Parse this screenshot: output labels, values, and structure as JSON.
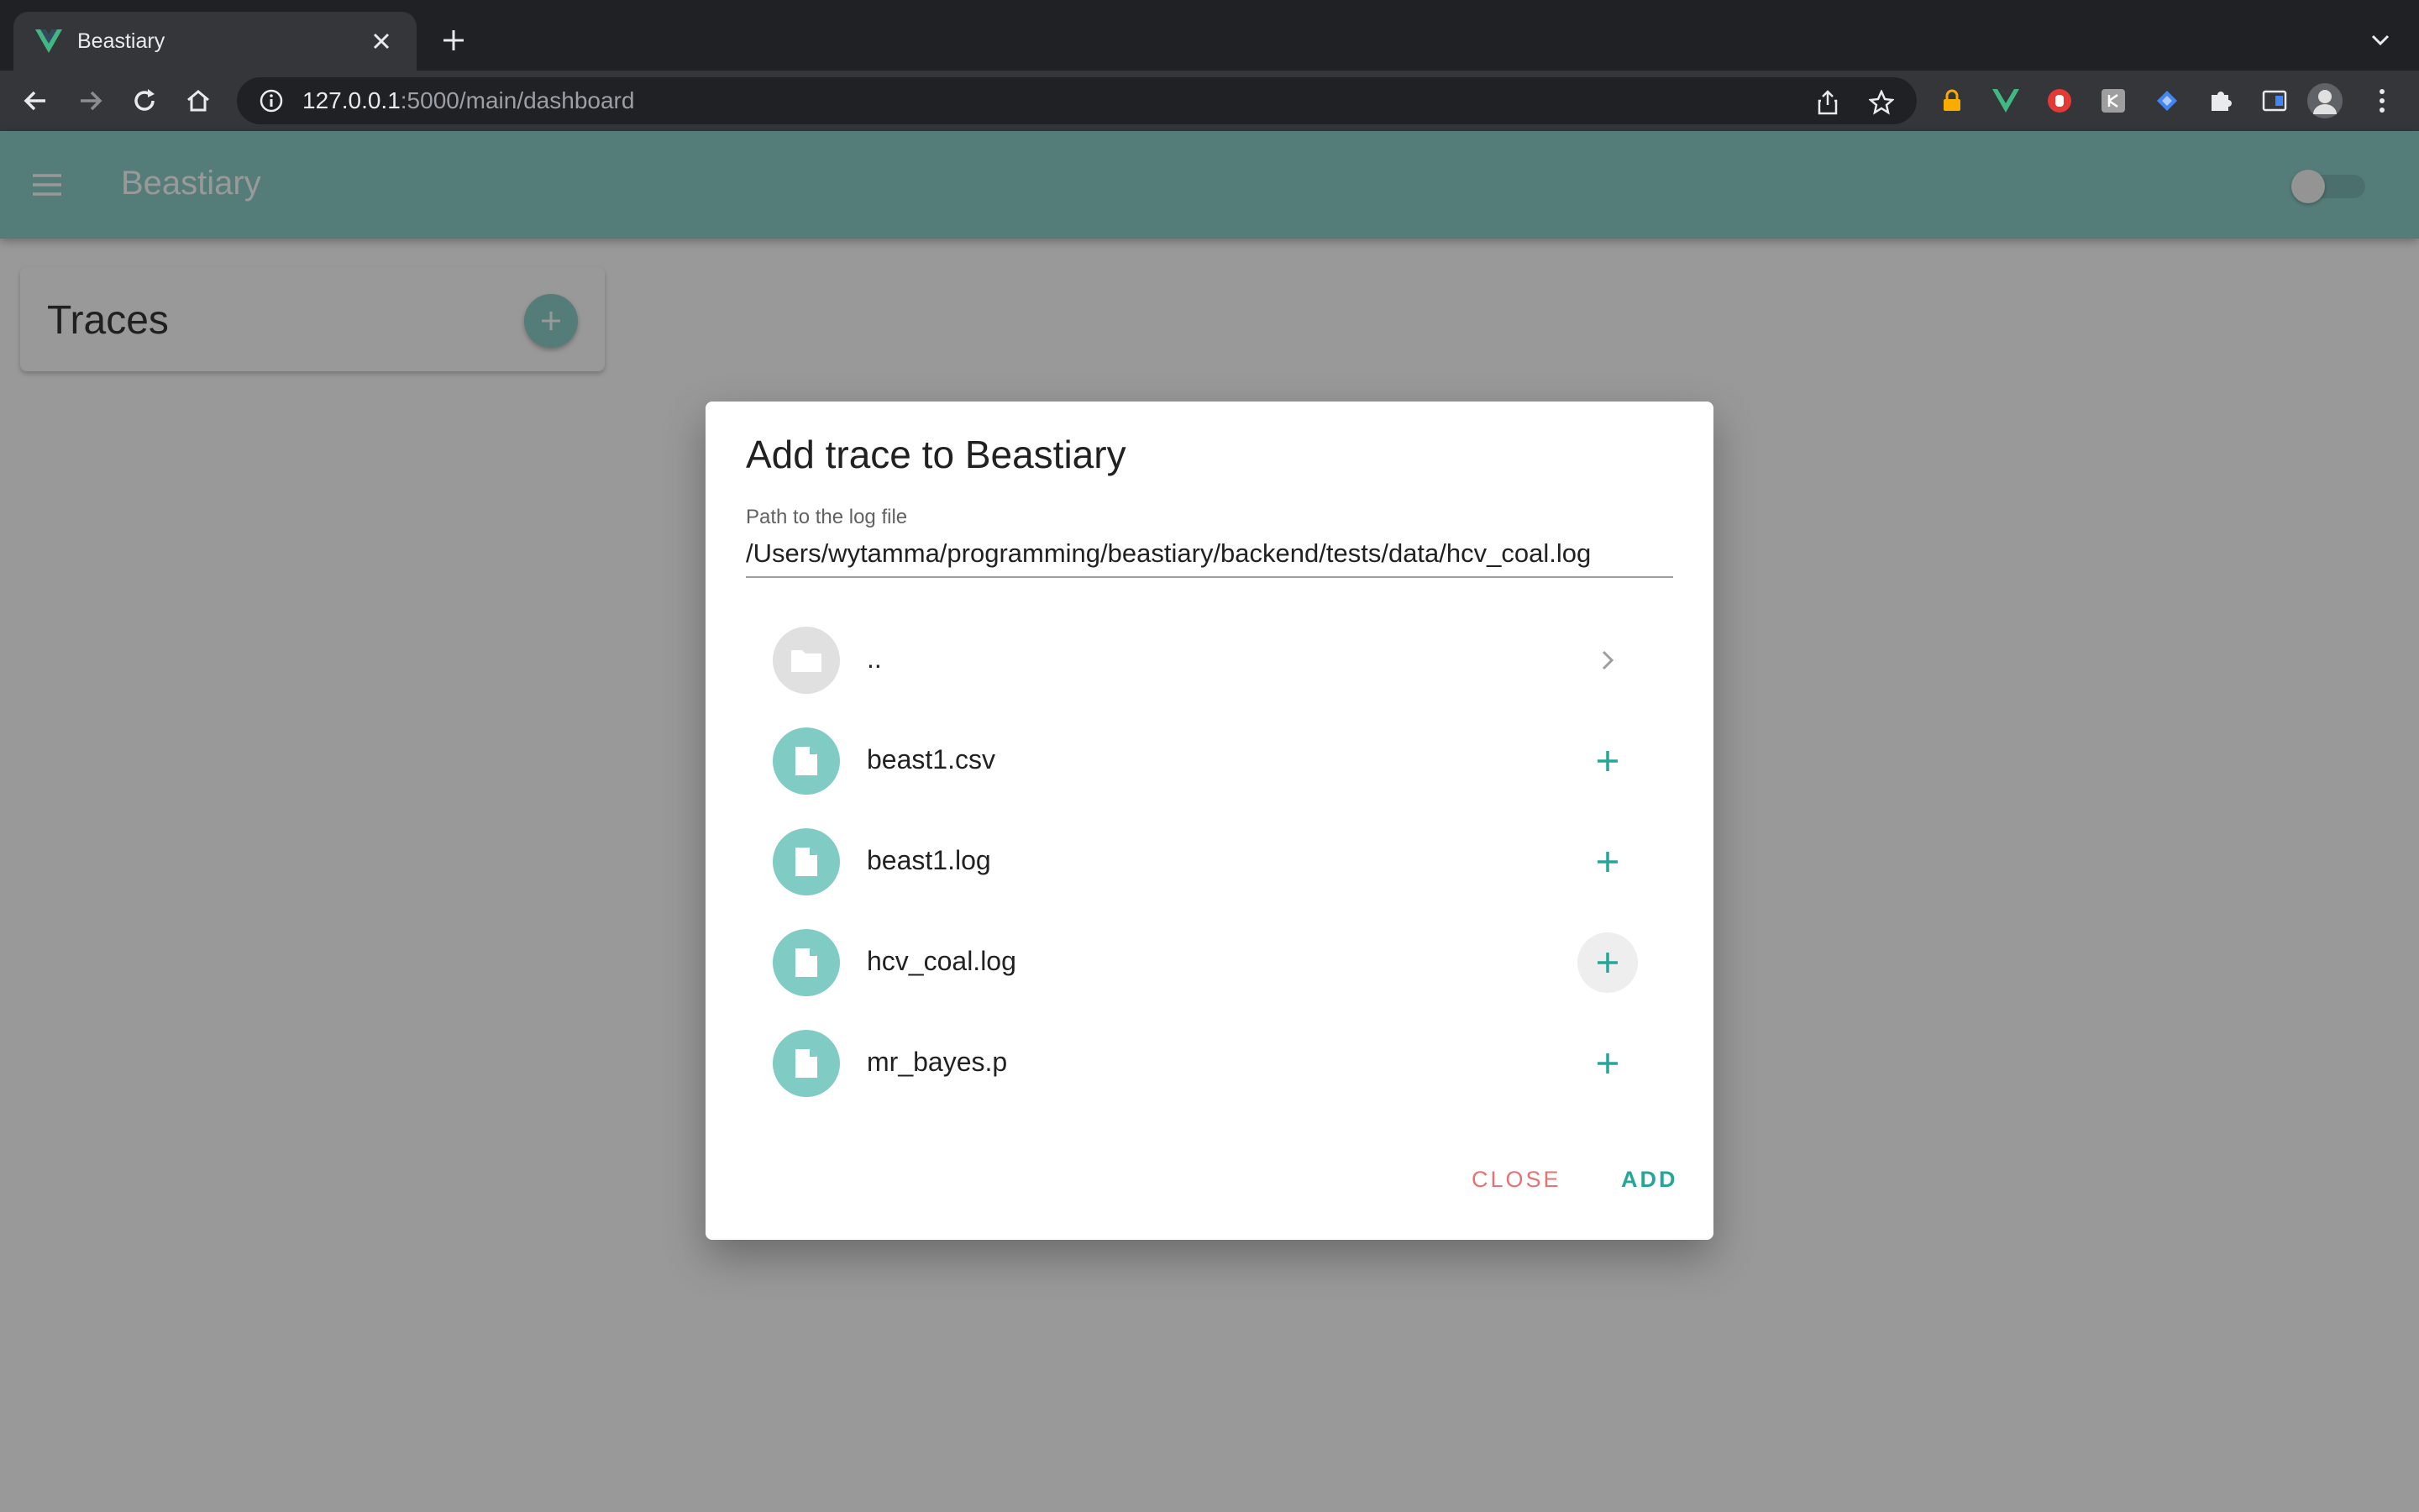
{
  "browser": {
    "tab_title": "Beastiary",
    "url_host": "127.0.0.1",
    "url_rest": ":5000/main/dashboard"
  },
  "app": {
    "title": "Beastiary",
    "accent_color": "#80cbc4",
    "traces_title": "Traces",
    "dark_mode_on": false
  },
  "dialog": {
    "title": "Add trace to Beastiary",
    "path_label": "Path to the log file",
    "path_value": "/Users/wytamma/programming/beastiary/backend/tests/data/hcv_coal.log",
    "files": [
      {
        "name": "..",
        "kind": "folder",
        "action": "chevron-right-icon"
      },
      {
        "name": "beast1.csv",
        "kind": "file",
        "action": "plus-icon"
      },
      {
        "name": "beast1.log",
        "kind": "file",
        "action": "plus-icon"
      },
      {
        "name": "hcv_coal.log",
        "kind": "file",
        "action": "plus-icon"
      },
      {
        "name": "mr_bayes.p",
        "kind": "file",
        "action": "plus-icon"
      }
    ],
    "close_label": "CLOSE",
    "add_label": "ADD"
  }
}
